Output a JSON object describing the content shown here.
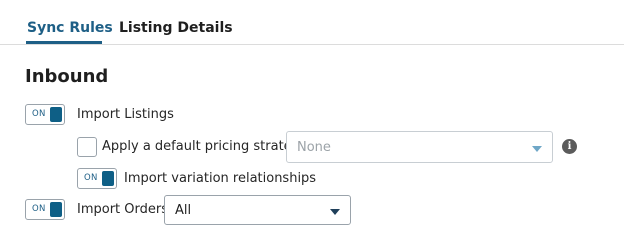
{
  "tabs": [
    {
      "label": "Sync Rules",
      "active": true
    },
    {
      "label": "Listing Details",
      "active": false
    }
  ],
  "section": {
    "title": "Inbound"
  },
  "import_listings": {
    "toggle_label": "ON",
    "toggle_on": true,
    "label": "Import Listings"
  },
  "pricing_strategy": {
    "checkbox_label": "Apply a default pricing strategy",
    "checked": false,
    "select_value": "None",
    "select_disabled": true,
    "info_icon": "info-icon"
  },
  "variation": {
    "toggle_label": "ON",
    "toggle_on": true,
    "label": "Import variation relationships"
  },
  "import_orders": {
    "toggle_label": "ON",
    "toggle_on": true,
    "label": "Import Orders",
    "select_value": "All"
  },
  "colors": {
    "accent": "#1e5f86",
    "toggle_knob": "#0e5f86",
    "text": "#262626"
  }
}
